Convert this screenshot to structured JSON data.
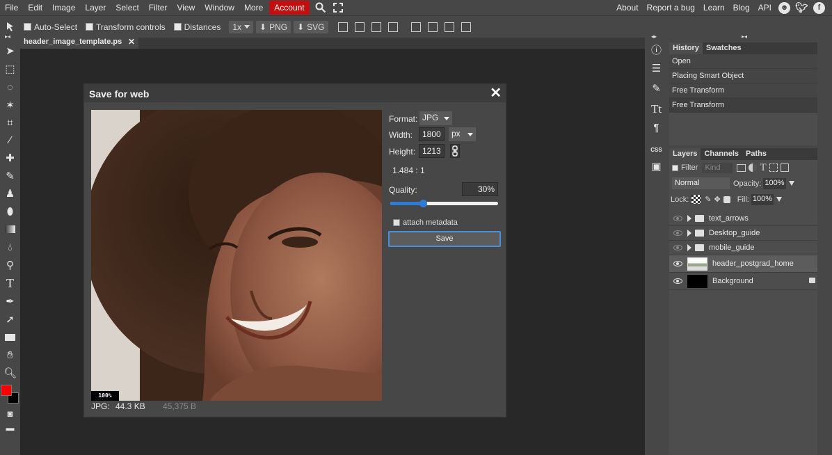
{
  "menu": {
    "items": [
      "File",
      "Edit",
      "Image",
      "Layer",
      "Select",
      "Filter",
      "View",
      "Window",
      "More"
    ],
    "account_label": "Account",
    "right_items": [
      "About",
      "Report a bug",
      "Learn",
      "Blog",
      "API"
    ]
  },
  "options": {
    "auto_select": "Auto-Select",
    "transform_controls": "Transform controls",
    "distances": "Distances",
    "zoom": "1x",
    "png": "PNG",
    "svg": "SVG"
  },
  "document_tab": {
    "title": "header_image_template.ps"
  },
  "dialog": {
    "title": "Save for web",
    "format_label": "Format:",
    "format_value": "JPG",
    "width_label": "Width:",
    "width_value": "1800",
    "unit_value": "px",
    "height_label": "Height:",
    "height_value": "1213",
    "ratio": "1.484 : 1",
    "quality_label": "Quality:",
    "quality_value": "30%",
    "quality_fraction": 0.3,
    "attach_metadata": "attach metadata",
    "save_label": "Save",
    "preview_zoom": "100%",
    "file_type": "JPG:",
    "file_size": "44.3 KB",
    "file_bytes": "45,375 B"
  },
  "history_panel": {
    "tabs": [
      "History",
      "Swatches"
    ],
    "entries": [
      "Open",
      "Placing Smart Object",
      "Free Transform",
      "Free Transform"
    ]
  },
  "layers_panel": {
    "tabs": [
      "Layers",
      "Channels",
      "Paths"
    ],
    "filter_label": "Filter",
    "kind_label": "Kind",
    "blend_mode": "Normal",
    "opacity_label": "Opacity:",
    "opacity_value": "100%",
    "lock_label": "Lock:",
    "fill_label": "Fill:",
    "fill_value": "100%",
    "layers": [
      {
        "name": "text_arrows",
        "type": "folder",
        "visible": false
      },
      {
        "name": "Desktop_guide",
        "type": "folder",
        "visible": false
      },
      {
        "name": "mobile_guide",
        "type": "folder",
        "visible": false
      },
      {
        "name": "header_postgrad_home",
        "type": "smart",
        "visible": true,
        "selected": true
      },
      {
        "name": "Background",
        "type": "fill",
        "visible": true,
        "locked": true
      }
    ]
  },
  "colors": {
    "accent": "#c20f0f",
    "foreground": "#ff0000",
    "background": "#000000",
    "slider": "#2f7bd6"
  }
}
